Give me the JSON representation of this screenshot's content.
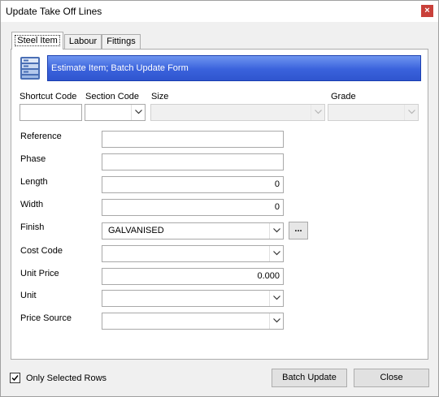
{
  "window": {
    "title": "Update Take Off Lines",
    "close_glyph": "×"
  },
  "tabs": [
    {
      "label": "Steel Item",
      "active": true
    },
    {
      "label": "Labour",
      "active": false
    },
    {
      "label": "Fittings",
      "active": false
    }
  ],
  "banner": {
    "text": "Estimate Item; Batch Update Form",
    "icon": "database-stack-icon"
  },
  "top_fields": {
    "shortcut_code": {
      "label": "Shortcut Code",
      "value": ""
    },
    "section_code": {
      "label": "Section Code",
      "value": ""
    },
    "size": {
      "label": "Size",
      "value": ""
    },
    "grade": {
      "label": "Grade",
      "value": ""
    }
  },
  "form": {
    "reference": {
      "label": "Reference",
      "value": ""
    },
    "phase": {
      "label": "Phase",
      "value": ""
    },
    "length": {
      "label": "Length",
      "value": "0"
    },
    "width": {
      "label": "Width",
      "value": "0"
    },
    "finish": {
      "label": "Finish",
      "value": "GALVANISED",
      "browse_label": "..."
    },
    "cost_code": {
      "label": "Cost Code",
      "value": ""
    },
    "unit_price": {
      "label": "Unit Price",
      "value": "0.000"
    },
    "unit": {
      "label": "Unit",
      "value": ""
    },
    "price_source": {
      "label": "Price Source",
      "value": ""
    }
  },
  "footer": {
    "only_selected_rows": {
      "label": "Only Selected Rows",
      "checked": true
    },
    "batch_update_label": "Batch Update",
    "close_label": "Close"
  },
  "colors": {
    "banner_top": "#6e95f0",
    "banner_bottom": "#2f55cf",
    "close_red": "#c9403a"
  }
}
